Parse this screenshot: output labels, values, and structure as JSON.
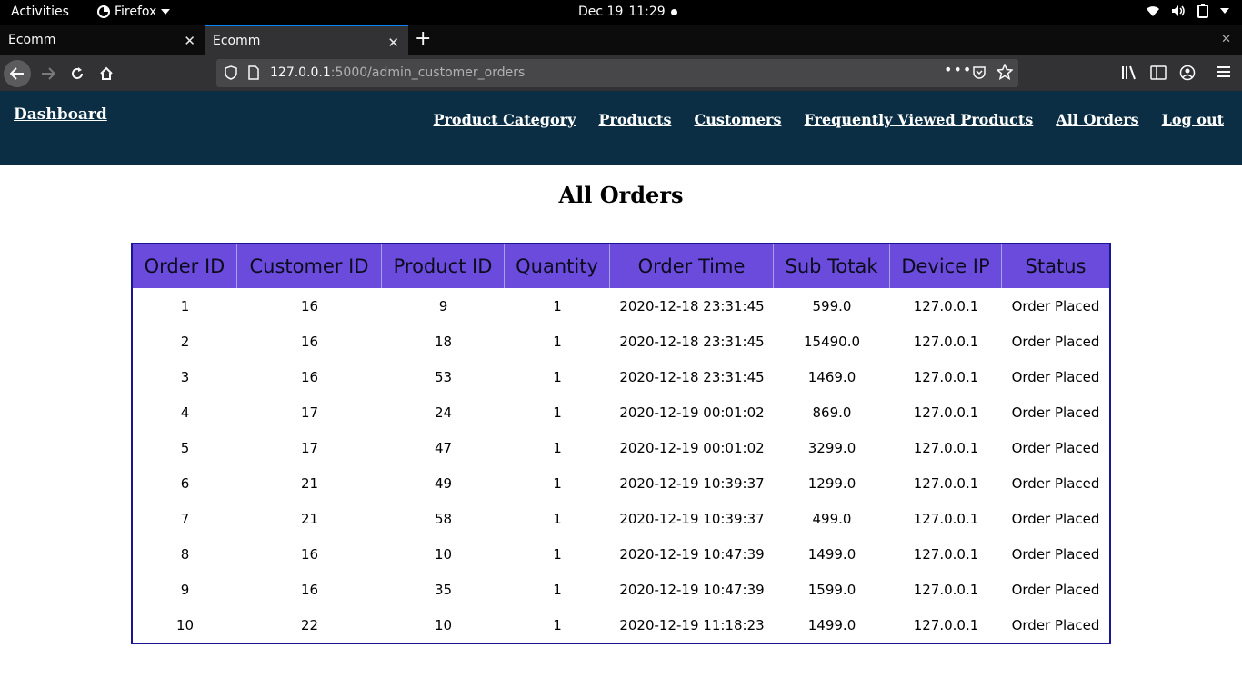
{
  "system_bar": {
    "activities": "Activities",
    "app_name": "Firefox",
    "date": "Dec 19",
    "time": "11:29"
  },
  "browser": {
    "tabs": [
      {
        "title": "Ecomm",
        "active": false
      },
      {
        "title": "Ecomm",
        "active": true
      }
    ],
    "url_host": "127.0.0.1",
    "url_path": ":5000/admin_customer_orders",
    "accent_color": "#0a84ff"
  },
  "site": {
    "brand": "Dashboard",
    "nav": [
      "Product Category",
      "Products",
      "Customers",
      "Frequently Viewed Products",
      "All Orders",
      "Log out"
    ],
    "header_color": "#0b2e44"
  },
  "page": {
    "title": "All Orders"
  },
  "orders_table": {
    "header_color": "#6a4bdb",
    "columns": [
      "Order ID",
      "Customer ID",
      "Product ID",
      "Quantity",
      "Order Time",
      "Sub Totak",
      "Device IP",
      "Status"
    ],
    "rows": [
      [
        "1",
        "16",
        "9",
        "1",
        "2020-12-18 23:31:45",
        "599.0",
        "127.0.0.1",
        "Order Placed"
      ],
      [
        "2",
        "16",
        "18",
        "1",
        "2020-12-18 23:31:45",
        "15490.0",
        "127.0.0.1",
        "Order Placed"
      ],
      [
        "3",
        "16",
        "53",
        "1",
        "2020-12-18 23:31:45",
        "1469.0",
        "127.0.0.1",
        "Order Placed"
      ],
      [
        "4",
        "17",
        "24",
        "1",
        "2020-12-19 00:01:02",
        "869.0",
        "127.0.0.1",
        "Order Placed"
      ],
      [
        "5",
        "17",
        "47",
        "1",
        "2020-12-19 00:01:02",
        "3299.0",
        "127.0.0.1",
        "Order Placed"
      ],
      [
        "6",
        "21",
        "49",
        "1",
        "2020-12-19 10:39:37",
        "1299.0",
        "127.0.0.1",
        "Order Placed"
      ],
      [
        "7",
        "21",
        "58",
        "1",
        "2020-12-19 10:39:37",
        "499.0",
        "127.0.0.1",
        "Order Placed"
      ],
      [
        "8",
        "16",
        "10",
        "1",
        "2020-12-19 10:47:39",
        "1499.0",
        "127.0.0.1",
        "Order Placed"
      ],
      [
        "9",
        "16",
        "35",
        "1",
        "2020-12-19 10:47:39",
        "1599.0",
        "127.0.0.1",
        "Order Placed"
      ],
      [
        "10",
        "22",
        "10",
        "1",
        "2020-12-19 11:18:23",
        "1499.0",
        "127.0.0.1",
        "Order Placed"
      ]
    ]
  }
}
